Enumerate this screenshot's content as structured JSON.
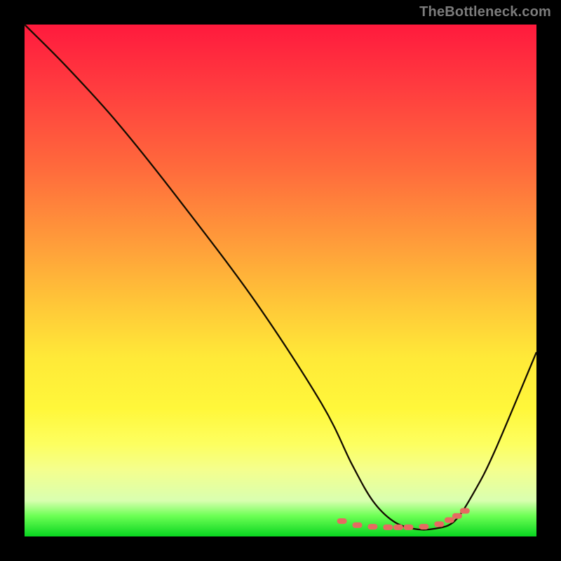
{
  "header": {
    "watermark": "TheBottleneck.com"
  },
  "colors": {
    "page_bg": "#000000",
    "curve_stroke": "#140d00",
    "marker_fill": "#e66a61",
    "gradient_top": "#ff1a3d",
    "gradient_bottom": "#08d520"
  },
  "chart_data": {
    "type": "line",
    "title": "",
    "xlabel": "",
    "ylabel": "",
    "xlim": [
      0,
      100
    ],
    "ylim": [
      0,
      100
    ],
    "grid": false,
    "series": [
      {
        "name": "curve",
        "x": [
          0,
          8,
          18,
          30,
          45,
          58,
          64,
          68,
          72,
          76,
          80,
          84,
          88,
          92,
          100
        ],
        "y": [
          100,
          92,
          81,
          66,
          46,
          26,
          14,
          7,
          3,
          1.5,
          1.5,
          3,
          9,
          17,
          36
        ]
      }
    ],
    "markers": {
      "name": "bottom-cluster",
      "x": [
        62,
        65,
        68,
        71,
        73,
        75,
        78,
        81,
        83,
        84.5,
        86
      ],
      "y": [
        3.0,
        2.2,
        1.9,
        1.8,
        1.8,
        1.8,
        1.9,
        2.4,
        3.2,
        4.0,
        5.0
      ]
    }
  }
}
